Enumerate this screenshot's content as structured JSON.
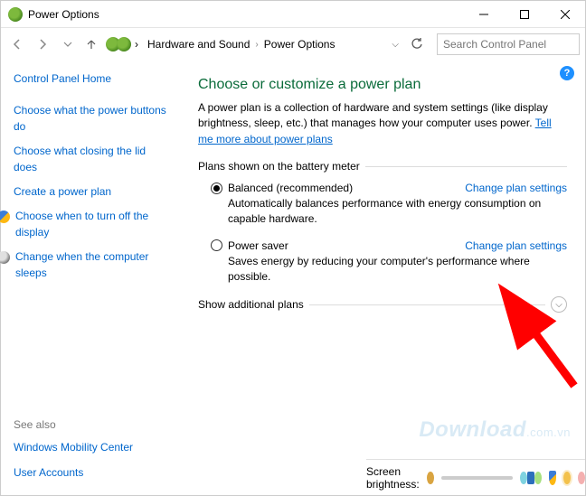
{
  "window": {
    "title": "Power Options"
  },
  "breadcrumbs": {
    "a": "Hardware and Sound",
    "b": "Power Options"
  },
  "search": {
    "placeholder": "Search Control Panel"
  },
  "sidebar": {
    "home": "Control Panel Home",
    "links": [
      "Choose what the power buttons do",
      "Choose what closing the lid does",
      "Create a power plan",
      "Choose when to turn off the display",
      "Change when the computer sleeps"
    ],
    "seealso_label": "See also",
    "seealso": [
      "Windows Mobility Center",
      "User Accounts"
    ]
  },
  "main": {
    "heading": "Choose or customize a power plan",
    "description": "A power plan is a collection of hardware and system settings (like display brightness, sleep, etc.) that manages how your computer uses power. ",
    "tell_me": "Tell me more about power plans",
    "plans_label": "Plans shown on the battery meter",
    "plans": [
      {
        "name": "Balanced (recommended)",
        "desc": "Automatically balances performance with energy consumption on capable hardware.",
        "selected": true
      },
      {
        "name": "Power saver",
        "desc": "Saves energy by reducing your computer's performance where possible.",
        "selected": false
      }
    ],
    "change_link": "Change plan settings",
    "additional_label": "Show additional plans"
  },
  "footer": {
    "brightness_label": "Screen brightness:"
  },
  "watermark": {
    "text": "Download",
    "suffix": ".com.vn"
  }
}
